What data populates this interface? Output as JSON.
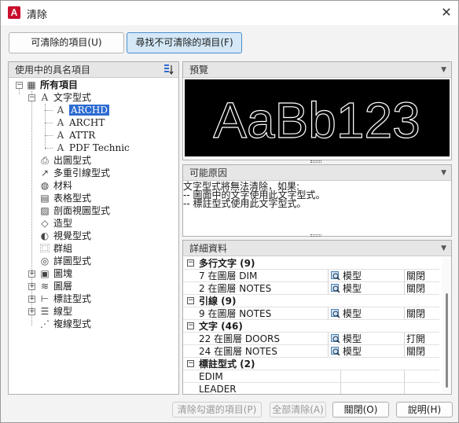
{
  "window": {
    "title": "清除",
    "app_icon": "A",
    "close_glyph": "✕"
  },
  "tabs": [
    {
      "label": "可清除的項目(U)",
      "active": false
    },
    {
      "label": "尋找不可清除的項目(F)",
      "active": true
    }
  ],
  "tree_panel": {
    "title": "使用中的具名項目",
    "sort_icon": "sort-icon",
    "root": "所有項目",
    "text_styles": {
      "label": "文字型式",
      "children": [
        "ARCHD",
        "ARCHT",
        "ATTR",
        "PDF Technic"
      ],
      "selected": "ARCHD"
    },
    "items": [
      {
        "label": "出圖型式",
        "icon": "plot-style-icon"
      },
      {
        "label": "多重引線型式",
        "icon": "multileader-icon"
      },
      {
        "label": "材料",
        "icon": "material-icon"
      },
      {
        "label": "表格型式",
        "icon": "table-style-icon"
      },
      {
        "label": "剖面視圖型式",
        "icon": "section-view-icon"
      },
      {
        "label": "造型",
        "icon": "shape-icon"
      },
      {
        "label": "視覺型式",
        "icon": "visual-style-icon"
      },
      {
        "label": "群組",
        "icon": "group-icon"
      },
      {
        "label": "詳圖型式",
        "icon": "detail-view-icon"
      },
      {
        "label": "圖塊",
        "icon": "block-icon",
        "expandable": true
      },
      {
        "label": "圖層",
        "icon": "layer-icon",
        "expandable": true
      },
      {
        "label": "標註型式",
        "icon": "dimension-style-icon",
        "expandable": true
      },
      {
        "label": "線型",
        "icon": "linetype-icon",
        "expandable": true
      },
      {
        "label": "複線型式",
        "icon": "multiline-style-icon"
      }
    ]
  },
  "preview": {
    "title": "預覽",
    "sample_text": "AaBb123"
  },
  "reason": {
    "title": "可能原因",
    "lines": [
      "文字型式將無法清除，如果:",
      "-- 圖面中的文字使用此文字型式。",
      "-- 標註型式使用此文字型式。"
    ]
  },
  "details": {
    "title": "詳細資料",
    "groups": [
      {
        "label": "多行文字 (9)",
        "rows": [
          {
            "name": "7 在圖層 DIM",
            "space": "模型",
            "state": "關閉"
          },
          {
            "name": "2 在圖層 NOTES",
            "space": "模型",
            "state": "關閉"
          }
        ]
      },
      {
        "label": "引線 (9)",
        "rows": [
          {
            "name": "9 在圖層 NOTES",
            "space": "模型",
            "state": "關閉"
          }
        ]
      },
      {
        "label": "文字 (46)",
        "rows": [
          {
            "name": "22 在圖層 DOORS",
            "space": "模型",
            "state": "打開"
          },
          {
            "name": "24 在圖層 NOTES",
            "space": "模型",
            "state": "關閉"
          }
        ]
      },
      {
        "label": "標註型式 (2)",
        "rows": [
          {
            "name": "EDIM",
            "space": "",
            "state": ""
          },
          {
            "name": "LEADER",
            "space": "",
            "state": ""
          }
        ]
      }
    ]
  },
  "buttons": {
    "purge_checked": "清除勾選的項目(P)",
    "purge_all": "全部清除(A)",
    "close": "關閉(O)",
    "help": "說明(H)"
  }
}
